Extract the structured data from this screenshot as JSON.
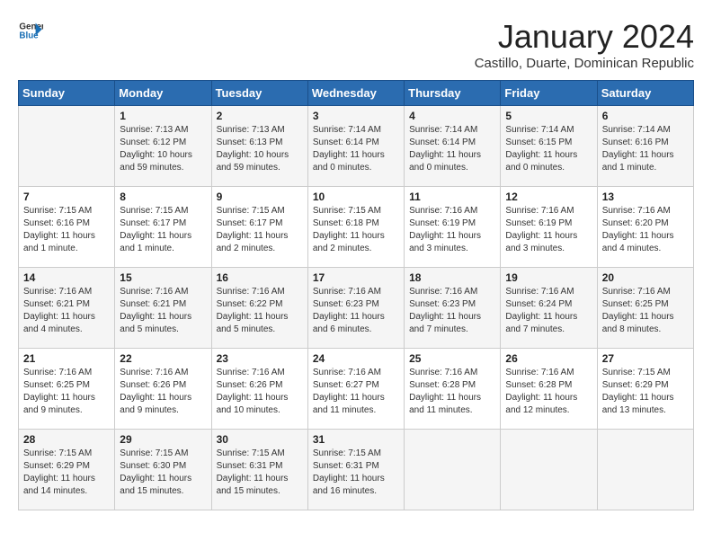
{
  "header": {
    "logo_line1": "General",
    "logo_line2": "Blue",
    "month_title": "January 2024",
    "location": "Castillo, Duarte, Dominican Republic"
  },
  "weekdays": [
    "Sunday",
    "Monday",
    "Tuesday",
    "Wednesday",
    "Thursday",
    "Friday",
    "Saturday"
  ],
  "weeks": [
    [
      {
        "day": "",
        "sunrise": "",
        "sunset": "",
        "daylight": ""
      },
      {
        "day": "1",
        "sunrise": "7:13 AM",
        "sunset": "6:12 PM",
        "daylight": "10 hours and 59 minutes."
      },
      {
        "day": "2",
        "sunrise": "7:13 AM",
        "sunset": "6:13 PM",
        "daylight": "10 hours and 59 minutes."
      },
      {
        "day": "3",
        "sunrise": "7:14 AM",
        "sunset": "6:14 PM",
        "daylight": "11 hours and 0 minutes."
      },
      {
        "day": "4",
        "sunrise": "7:14 AM",
        "sunset": "6:14 PM",
        "daylight": "11 hours and 0 minutes."
      },
      {
        "day": "5",
        "sunrise": "7:14 AM",
        "sunset": "6:15 PM",
        "daylight": "11 hours and 0 minutes."
      },
      {
        "day": "6",
        "sunrise": "7:14 AM",
        "sunset": "6:16 PM",
        "daylight": "11 hours and 1 minute."
      }
    ],
    [
      {
        "day": "7",
        "sunrise": "7:15 AM",
        "sunset": "6:16 PM",
        "daylight": "11 hours and 1 minute."
      },
      {
        "day": "8",
        "sunrise": "7:15 AM",
        "sunset": "6:17 PM",
        "daylight": "11 hours and 1 minute."
      },
      {
        "day": "9",
        "sunrise": "7:15 AM",
        "sunset": "6:17 PM",
        "daylight": "11 hours and 2 minutes."
      },
      {
        "day": "10",
        "sunrise": "7:15 AM",
        "sunset": "6:18 PM",
        "daylight": "11 hours and 2 minutes."
      },
      {
        "day": "11",
        "sunrise": "7:16 AM",
        "sunset": "6:19 PM",
        "daylight": "11 hours and 3 minutes."
      },
      {
        "day": "12",
        "sunrise": "7:16 AM",
        "sunset": "6:19 PM",
        "daylight": "11 hours and 3 minutes."
      },
      {
        "day": "13",
        "sunrise": "7:16 AM",
        "sunset": "6:20 PM",
        "daylight": "11 hours and 4 minutes."
      }
    ],
    [
      {
        "day": "14",
        "sunrise": "7:16 AM",
        "sunset": "6:21 PM",
        "daylight": "11 hours and 4 minutes."
      },
      {
        "day": "15",
        "sunrise": "7:16 AM",
        "sunset": "6:21 PM",
        "daylight": "11 hours and 5 minutes."
      },
      {
        "day": "16",
        "sunrise": "7:16 AM",
        "sunset": "6:22 PM",
        "daylight": "11 hours and 5 minutes."
      },
      {
        "day": "17",
        "sunrise": "7:16 AM",
        "sunset": "6:23 PM",
        "daylight": "11 hours and 6 minutes."
      },
      {
        "day": "18",
        "sunrise": "7:16 AM",
        "sunset": "6:23 PM",
        "daylight": "11 hours and 7 minutes."
      },
      {
        "day": "19",
        "sunrise": "7:16 AM",
        "sunset": "6:24 PM",
        "daylight": "11 hours and 7 minutes."
      },
      {
        "day": "20",
        "sunrise": "7:16 AM",
        "sunset": "6:25 PM",
        "daylight": "11 hours and 8 minutes."
      }
    ],
    [
      {
        "day": "21",
        "sunrise": "7:16 AM",
        "sunset": "6:25 PM",
        "daylight": "11 hours and 9 minutes."
      },
      {
        "day": "22",
        "sunrise": "7:16 AM",
        "sunset": "6:26 PM",
        "daylight": "11 hours and 9 minutes."
      },
      {
        "day": "23",
        "sunrise": "7:16 AM",
        "sunset": "6:26 PM",
        "daylight": "11 hours and 10 minutes."
      },
      {
        "day": "24",
        "sunrise": "7:16 AM",
        "sunset": "6:27 PM",
        "daylight": "11 hours and 11 minutes."
      },
      {
        "day": "25",
        "sunrise": "7:16 AM",
        "sunset": "6:28 PM",
        "daylight": "11 hours and 11 minutes."
      },
      {
        "day": "26",
        "sunrise": "7:16 AM",
        "sunset": "6:28 PM",
        "daylight": "11 hours and 12 minutes."
      },
      {
        "day": "27",
        "sunrise": "7:15 AM",
        "sunset": "6:29 PM",
        "daylight": "11 hours and 13 minutes."
      }
    ],
    [
      {
        "day": "28",
        "sunrise": "7:15 AM",
        "sunset": "6:29 PM",
        "daylight": "11 hours and 14 minutes."
      },
      {
        "day": "29",
        "sunrise": "7:15 AM",
        "sunset": "6:30 PM",
        "daylight": "11 hours and 15 minutes."
      },
      {
        "day": "30",
        "sunrise": "7:15 AM",
        "sunset": "6:31 PM",
        "daylight": "11 hours and 15 minutes."
      },
      {
        "day": "31",
        "sunrise": "7:15 AM",
        "sunset": "6:31 PM",
        "daylight": "11 hours and 16 minutes."
      },
      {
        "day": "",
        "sunrise": "",
        "sunset": "",
        "daylight": ""
      },
      {
        "day": "",
        "sunrise": "",
        "sunset": "",
        "daylight": ""
      },
      {
        "day": "",
        "sunrise": "",
        "sunset": "",
        "daylight": ""
      }
    ]
  ]
}
